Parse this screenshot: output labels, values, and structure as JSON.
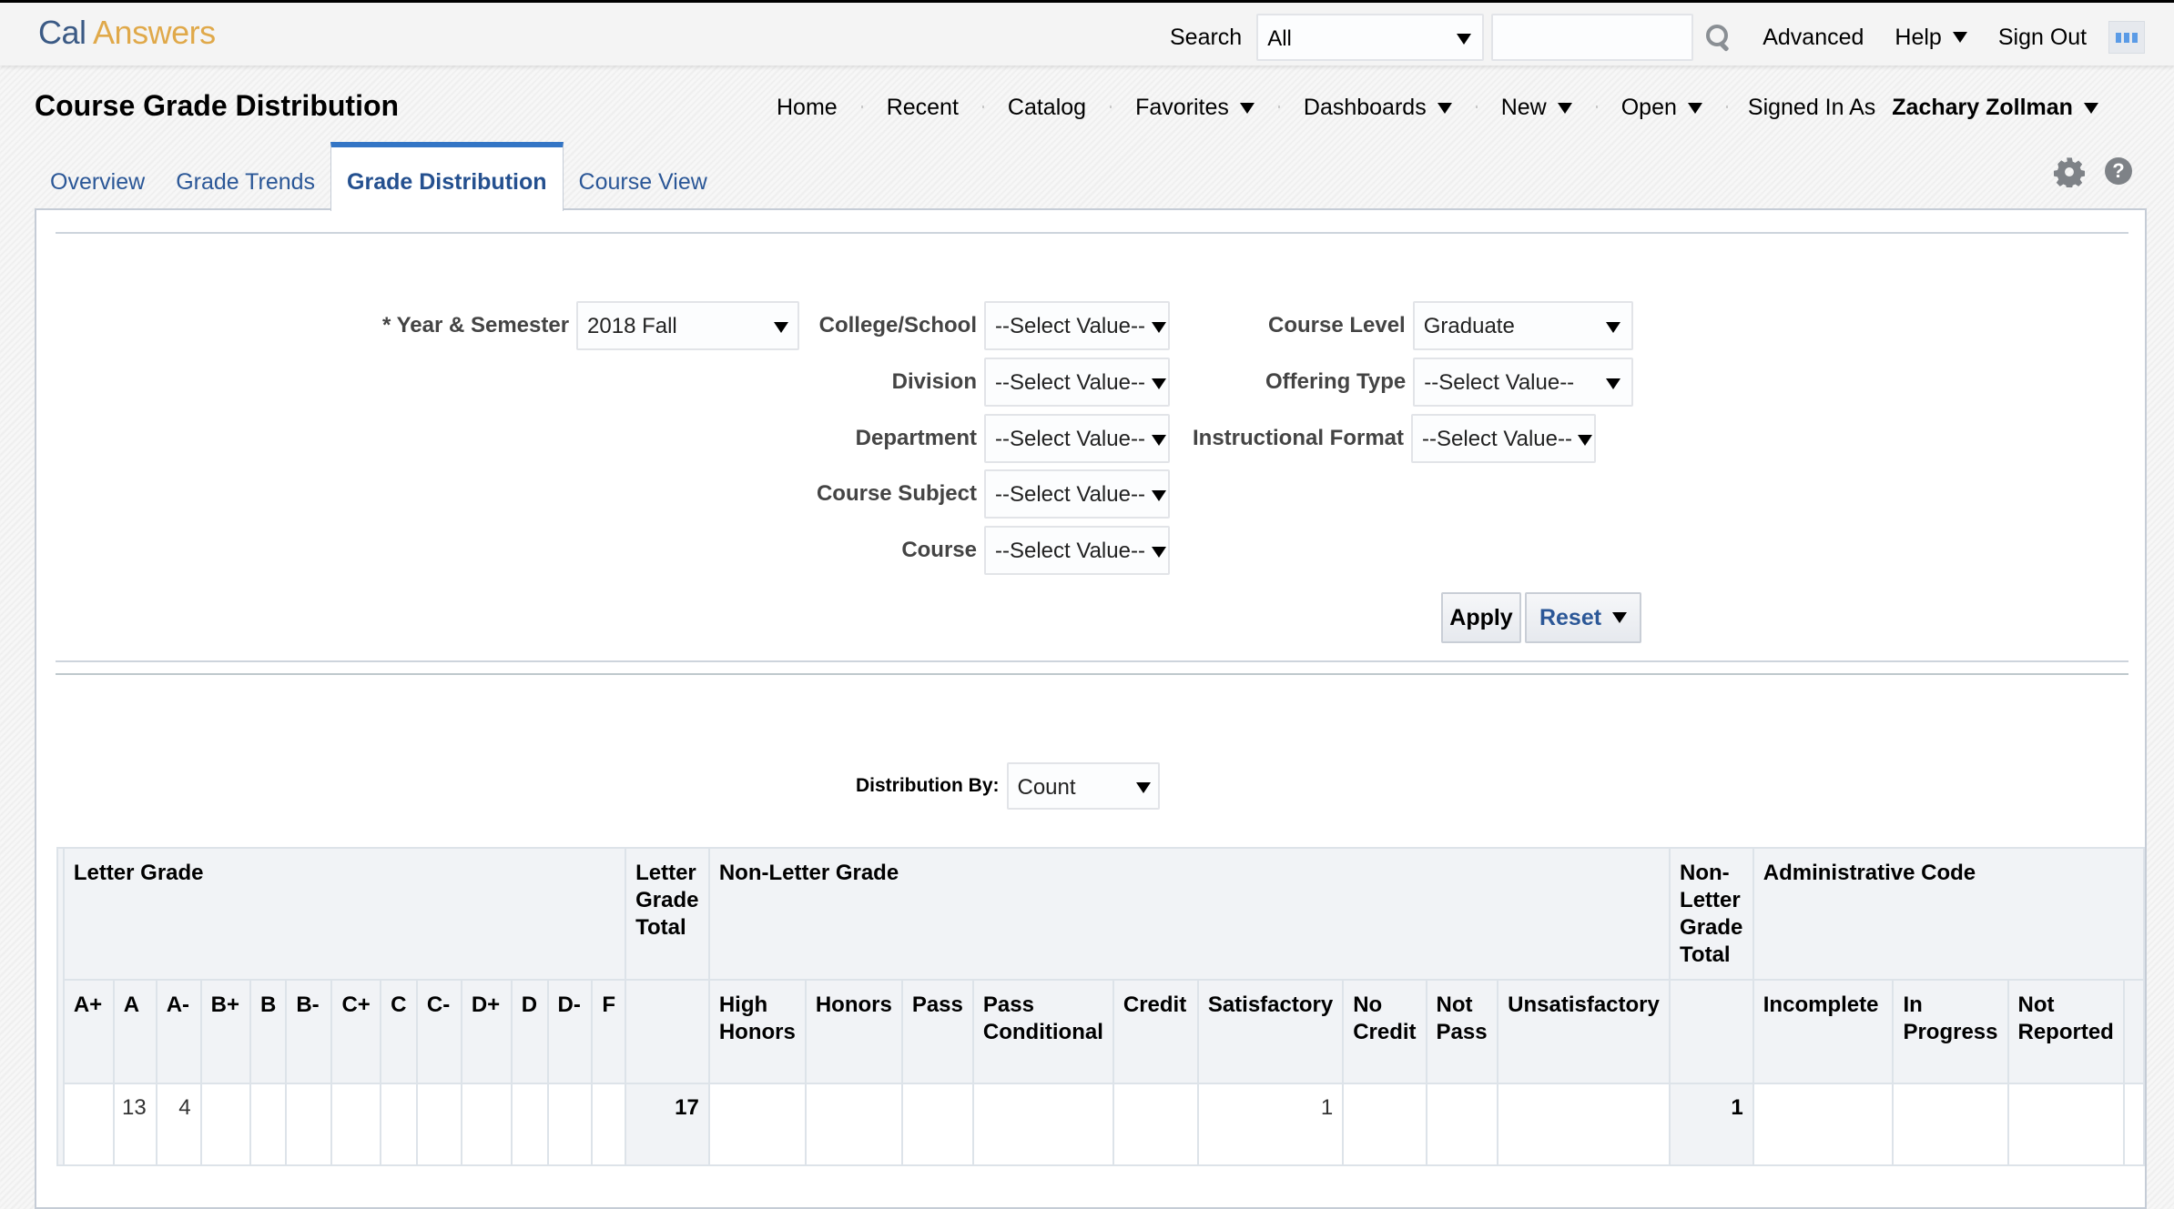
{
  "brand": {
    "part1": "Cal",
    "part2": "Answers"
  },
  "topbar": {
    "search_label": "Search",
    "search_scope": "All",
    "search_query": "",
    "advanced": "Advanced",
    "help": "Help",
    "sign_out": "Sign Out"
  },
  "page_title": "Course Grade Distribution",
  "nav": {
    "home": "Home",
    "recent": "Recent",
    "catalog": "Catalog",
    "favorites": "Favorites",
    "dashboards": "Dashboards",
    "new": "New",
    "open": "Open",
    "signed_in_as": "Signed In As",
    "user": "Zachary Zollman"
  },
  "tabs": [
    {
      "label": "Overview",
      "active": false
    },
    {
      "label": "Grade Trends",
      "active": false
    },
    {
      "label": "Grade Distribution",
      "active": true
    },
    {
      "label": "Course View",
      "active": false
    }
  ],
  "prompts": {
    "year_semester": {
      "label": "* Year & Semester",
      "value": "2018 Fall"
    },
    "college_school": {
      "label": "College/School",
      "value": "--Select Value--"
    },
    "division": {
      "label": "Division",
      "value": "--Select Value--"
    },
    "department": {
      "label": "Department",
      "value": "--Select Value--"
    },
    "course_subject": {
      "label": "Course Subject",
      "value": "--Select Value--"
    },
    "course": {
      "label": "Course",
      "value": "--Select Value--"
    },
    "course_level": {
      "label": "Course Level",
      "value": "Graduate"
    },
    "offering_type": {
      "label": "Offering Type",
      "value": "--Select Value--"
    },
    "instructional_format": {
      "label": "Instructional Format",
      "value": "--Select Value--"
    },
    "apply": "Apply",
    "reset": "Reset"
  },
  "distribution_by": {
    "label": "Distribution By:",
    "value": "Count"
  },
  "table": {
    "groups": {
      "letter_grade": "Letter Grade",
      "letter_grade_total": "Letter Grade Total",
      "non_letter_grade": "Non-Letter Grade",
      "non_letter_grade_total": "Non-Letter Grade Total",
      "administrative_code": "Administrative Code"
    },
    "letter_columns": [
      "A+",
      "A",
      "A-",
      "B+",
      "B",
      "B-",
      "C+",
      "C",
      "C-",
      "D+",
      "D",
      "D-",
      "F"
    ],
    "non_letter_columns": [
      "High Honors",
      "Honors",
      "Pass",
      "Pass Conditional",
      "Credit",
      "Satisfactory",
      "No Credit",
      "Not Pass",
      "Unsatisfactory"
    ],
    "admin_columns": [
      "Incomplete",
      "In Progress",
      "Not Reported"
    ],
    "row": {
      "letter": [
        "",
        "13",
        "4",
        "",
        "",
        "",
        "",
        "",
        "",
        "",
        "",
        "",
        ""
      ],
      "letter_total": "17",
      "non_letter": [
        "",
        "",
        "",
        "",
        "",
        "1",
        "",
        "",
        ""
      ],
      "non_letter_total": "1",
      "admin": [
        "",
        "",
        ""
      ]
    }
  }
}
